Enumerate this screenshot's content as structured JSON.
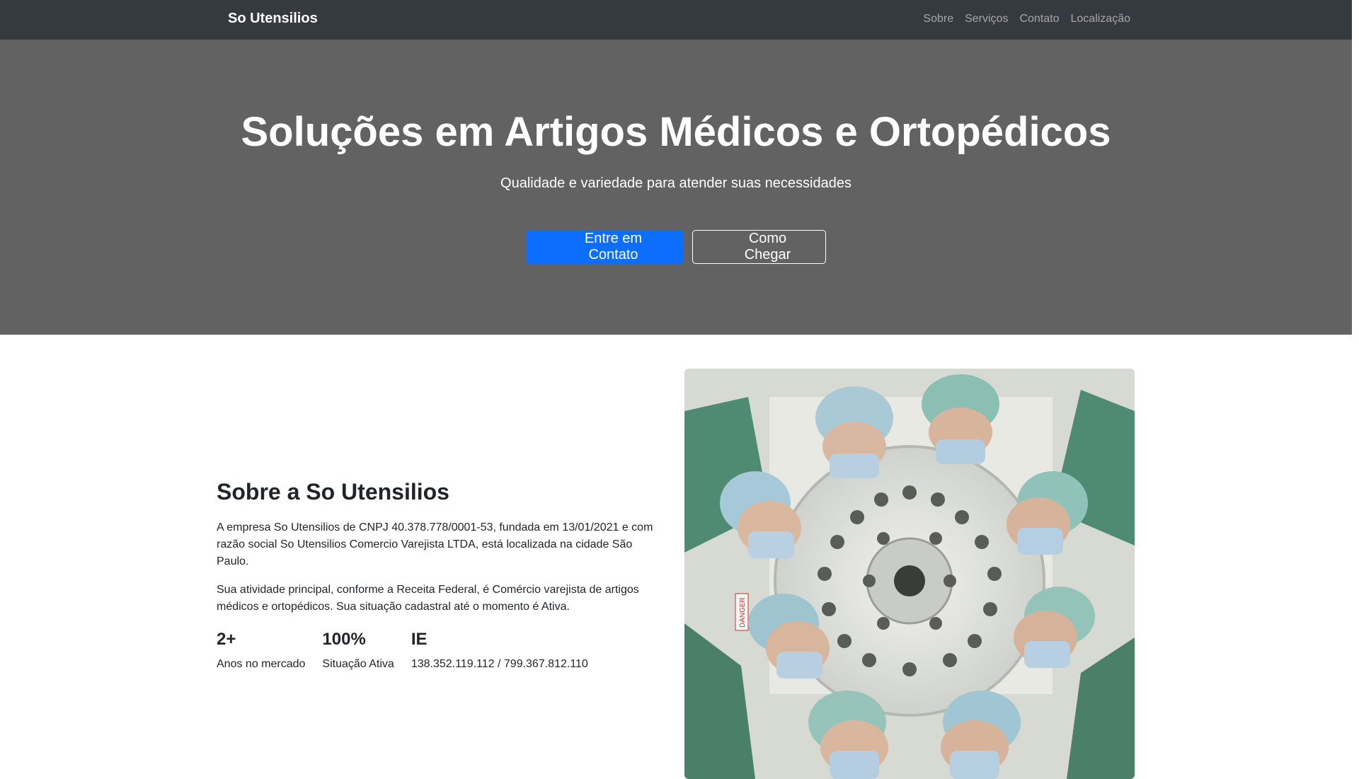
{
  "brand": "So Utensilios",
  "nav": {
    "items": [
      "Sobre",
      "Serviços",
      "Contato",
      "Localização"
    ]
  },
  "hero": {
    "title": "Soluções em Artigos Médicos e Ortopédicos",
    "subtitle": "Qualidade e variedade para atender suas necessidades",
    "primary_button": "Entre em Contato",
    "secondary_button": "Como Chegar"
  },
  "about": {
    "title": "Sobre a So Utensilios",
    "paragraph1": "A empresa So Utensilios de CNPJ 40.378.778/0001-53, fundada em 13/01/2021 e com razão social So Utensilios Comercio Varejista LTDA, está localizada na cidade São Paulo.",
    "paragraph2": "Sua atividade principal, conforme a Receita Federal, é Comércio varejista de artigos médicos e ortopédicos. Sua situação cadastral até o momento é Ativa.",
    "stats": [
      {
        "value": "2+",
        "label": "Anos no mercado"
      },
      {
        "value": "100%",
        "label": "Situação Ativa"
      },
      {
        "value": "IE",
        "label": "138.352.119.112 / 799.367.812.110"
      }
    ]
  },
  "image": {
    "sticker_text": "DANGER"
  },
  "colors": {
    "navbar": "#343a40",
    "hero_bg": "#626262",
    "primary": "#0d6efd"
  }
}
